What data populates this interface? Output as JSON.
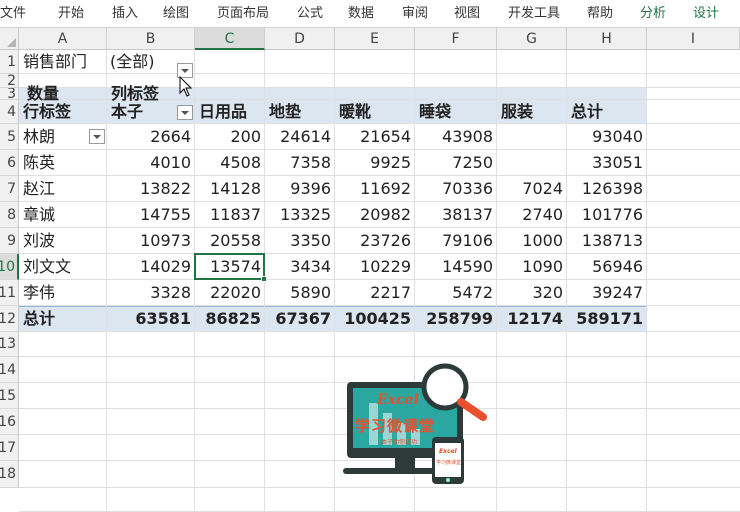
{
  "ribbon": {
    "tabs": [
      "文件",
      "开始",
      "插入",
      "绘图",
      "页面布局",
      "公式",
      "数据",
      "审阅",
      "视图",
      "开发工具",
      "帮助",
      "分析",
      "设计"
    ],
    "contextual_tabs": [
      "分析",
      "设计"
    ]
  },
  "sheet": {
    "columns": [
      "A",
      "B",
      "C",
      "D",
      "E",
      "F",
      "G",
      "H",
      "I"
    ],
    "selected_column": "C",
    "rows": [
      "1",
      "2",
      "3",
      "4",
      "5",
      "6",
      "7",
      "8",
      "9",
      "10",
      "11",
      "12",
      "13",
      "14",
      "15",
      "16",
      "17",
      "18"
    ],
    "selected_row": "10",
    "selected_cell": "C10"
  },
  "pivot": {
    "filter_label": "销售部门",
    "filter_value": "(全部)",
    "values_label": "数量",
    "column_labels": "列标签",
    "row_labels": "行标签",
    "headers": [
      "本子",
      "日用品",
      "地垫",
      "暖靴",
      "睡袋",
      "服装",
      "总计"
    ],
    "rows": [
      {
        "name": "林朗",
        "values": [
          "2664",
          "200",
          "24614",
          "21654",
          "43908",
          "",
          "93040"
        ]
      },
      {
        "name": "陈英",
        "values": [
          "4010",
          "4508",
          "7358",
          "9925",
          "7250",
          "",
          "33051"
        ]
      },
      {
        "name": "赵江",
        "values": [
          "13822",
          "14128",
          "9396",
          "11692",
          "70336",
          "7024",
          "126398"
        ]
      },
      {
        "name": "章诚",
        "values": [
          "14755",
          "11837",
          "13325",
          "20982",
          "38137",
          "2740",
          "101776"
        ]
      },
      {
        "name": "刘波",
        "values": [
          "10973",
          "20558",
          "3350",
          "23726",
          "79106",
          "1000",
          "138713"
        ]
      },
      {
        "name": "刘文文",
        "values": [
          "14029",
          "13574",
          "3434",
          "10229",
          "14590",
          "1090",
          "56946"
        ]
      },
      {
        "name": "李伟",
        "values": [
          "3328",
          "22020",
          "5890",
          "2217",
          "5472",
          "320",
          "39247"
        ]
      }
    ],
    "total_label": "总计",
    "totals": [
      "63581",
      "86825",
      "67367",
      "100425",
      "258799",
      "12174",
      "589171"
    ]
  },
  "logo": {
    "title": "Excel",
    "subtitle": "学习微课堂",
    "tagline": "本子助你成功",
    "device_title": "Excel",
    "device_subtitle": "学习微课堂"
  },
  "colors": {
    "accent": "#217346",
    "pivot_band": "#dce6f1",
    "logo_teal": "#2aa7a0",
    "logo_orange": "#e8502e",
    "logo_dark": "#2d3a3a"
  }
}
